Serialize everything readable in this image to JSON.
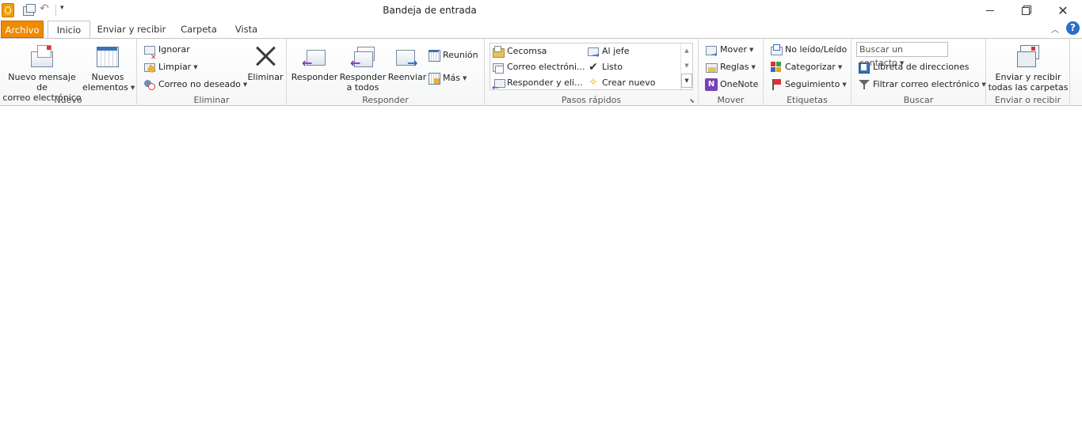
{
  "window": {
    "title": "Bandeja de entrada"
  },
  "tabs": [
    {
      "label": "Archivo"
    },
    {
      "label": "Inicio"
    },
    {
      "label": "Enviar y recibir"
    },
    {
      "label": "Carpeta"
    },
    {
      "label": "Vista"
    }
  ],
  "ribbon": {
    "nuevo": {
      "label": "Nuevo",
      "new_email_line1": "Nuevo mensaje de",
      "new_email_line2": "correo electrónico",
      "new_items_line1": "Nuevos",
      "new_items_line2": "elementos"
    },
    "eliminar": {
      "label": "Eliminar",
      "ignore": "Ignorar",
      "clean": "Limpiar",
      "junk": "Correo no deseado",
      "delete": "Eliminar"
    },
    "responder": {
      "label": "Responder",
      "reply": "Responder",
      "reply_all_line1": "Responder",
      "reply_all_line2": "a todos",
      "forward": "Reenviar",
      "meeting": "Reunión",
      "more": "Más"
    },
    "pasos_rapidos": {
      "label": "Pasos rápidos",
      "items": [
        "Cecomsa",
        "Al jefe",
        "Correo electróni...",
        "Listo",
        "Responder y eli...",
        "Crear nuevo"
      ]
    },
    "mover": {
      "label": "Mover",
      "move": "Mover",
      "rules": "Reglas",
      "onenote": "OneNote"
    },
    "etiquetas": {
      "label": "Etiquetas",
      "unread": "No leído/Leído",
      "categorize": "Categorizar",
      "followup": "Seguimiento"
    },
    "buscar": {
      "label": "Buscar",
      "search_placeholder": "Buscar un contacto",
      "address_book": "Libreta de direcciones",
      "filter": "Filtrar correo electrónico"
    },
    "enviar_recibir": {
      "label": "Enviar o recibir",
      "send_all_line1": "Enviar y recibir",
      "send_all_line2": "todas las carpetas"
    }
  },
  "colors": {
    "file_tab": "#f08a00",
    "accent_blue": "#2a6fc9"
  }
}
